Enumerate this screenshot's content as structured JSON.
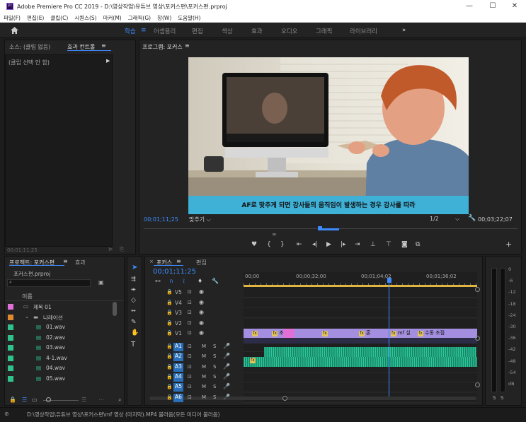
{
  "window": {
    "title": "Adobe Premiere Pro CC 2019 - D:\\영상작업\\유튜브 영상\\포커스편\\포커스편.prproj",
    "minimize": "—",
    "maximize": "☐",
    "close": "✕"
  },
  "menu": [
    "파일(F)",
    "편집(E)",
    "클립(C)",
    "시퀀스(S)",
    "마커(M)",
    "그래픽(G)",
    "창(W)",
    "도움말(H)"
  ],
  "workspaces": [
    "학습",
    "어셈블리",
    "편집",
    "색상",
    "효과",
    "오디오",
    "그래픽",
    "라이브러리"
  ],
  "workspace_more": "»",
  "source_panel": {
    "tabs": [
      "소스: (클립 없음)",
      "효과 컨트롤"
    ],
    "no_clip": "(클립 선택 안 함)",
    "timecode": "00;01;11;25"
  },
  "program_monitor": {
    "title": "프로그램: 포커스",
    "subtitle": "AF로 맞추게 되면 강사들의 움직임이 발생하는 경우 강사를 따라",
    "timecode_current": "00;01;11;25",
    "fit": "맞추기",
    "resolution": "1/2",
    "timecode_total": "00;03;22;07",
    "add": "+"
  },
  "project_panel": {
    "tabs": [
      "프로젝트: 포커스편",
      "효과"
    ],
    "file": "포커스편.prproj",
    "search_placeholder": "",
    "column_name": "이름",
    "items": [
      {
        "name": "제목 01",
        "color": "#e070d8",
        "type": "title"
      },
      {
        "name": "나레이션",
        "color": "#e08a30",
        "type": "folder"
      },
      {
        "name": "01.wav",
        "color": "#2fc38b",
        "type": "audio"
      },
      {
        "name": "02.wav",
        "color": "#2fc38b",
        "type": "audio"
      },
      {
        "name": "03.wav",
        "color": "#2fc38b",
        "type": "audio"
      },
      {
        "name": "4-1.wav",
        "color": "#2fc38b",
        "type": "audio"
      },
      {
        "name": "04.wav",
        "color": "#2fc38b",
        "type": "audio"
      },
      {
        "name": "05.wav",
        "color": "#2fc38b",
        "type": "audio"
      }
    ]
  },
  "timeline": {
    "tabs": [
      "포커스",
      "편집"
    ],
    "timecode": "00;01;11;25",
    "ruler": [
      "00;00",
      "00;00;32;00",
      "00;01;04;02",
      "00;01;36;02"
    ],
    "video_tracks": [
      "V5",
      "V4",
      "V3",
      "V2",
      "V1"
    ],
    "audio_tracks": [
      "A1",
      "A2",
      "A3",
      "A4",
      "A5",
      "A6"
    ],
    "track_toggle_m": "M",
    "track_toggle_s": "S",
    "v1_clips": [
      "초",
      "혼",
      "mf 설",
      "수동 초점"
    ]
  },
  "audio_meter": {
    "scale": [
      "0",
      "-6",
      "-12",
      "-18",
      "-24",
      "-30",
      "-36",
      "-42",
      "-48",
      "-54",
      "dB"
    ],
    "solo_left": "S",
    "solo_right": "S"
  },
  "status_bar": {
    "text": "D:\\영상작업\\유튜브 영상\\포커스편\\mf 영상 (마지막).MP4 불러옴(모든 미디어 불러옴)"
  },
  "colors": {
    "accent": "#3e8bff",
    "subtitle_bar": "#3fb0d6",
    "clip_purple": "#a48ee0",
    "audio_green": "#2ec79a"
  }
}
